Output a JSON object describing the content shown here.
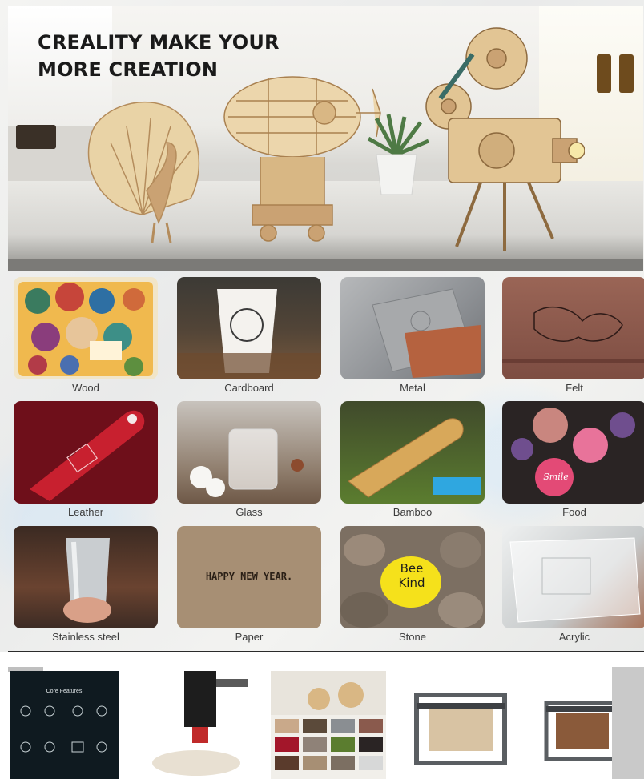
{
  "hero": {
    "title": "CREALITY MAKE YOUR\nMORE CREATION"
  },
  "materials": [
    {
      "label": "Wood",
      "tile_bg": "#f1e5c8"
    },
    {
      "label": "Cardboard",
      "tile_bg": "#5b4a3a"
    },
    {
      "label": "Metal",
      "tile_bg": "#8a8e92"
    },
    {
      "label": "Felt",
      "tile_bg": "#8a5a4d"
    },
    {
      "label": "Leather",
      "tile_bg": "#6e0f1a"
    },
    {
      "label": "Glass",
      "tile_bg": "#8f8278"
    },
    {
      "label": "Bamboo",
      "tile_bg": "#2f3a22"
    },
    {
      "label": "Food",
      "tile_bg": "#2a2424"
    },
    {
      "label": "Stainless steel",
      "tile_bg": "#5a3b2c"
    },
    {
      "label": "Paper",
      "tile_bg": "#a78f74"
    },
    {
      "label": "Stone",
      "tile_bg": "#7c6f62"
    },
    {
      "label": "Acrylic",
      "tile_bg": "#d7d8d8"
    }
  ],
  "tile_texts": {
    "paper": "HAPPY NEW YEAR.",
    "stone": "Bee\nKind",
    "food": "Smile"
  },
  "thumbnails": {
    "features_title": "Core Features"
  }
}
